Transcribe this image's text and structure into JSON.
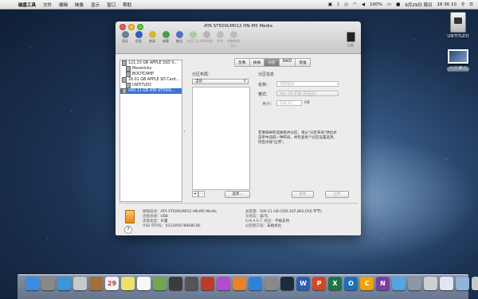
{
  "menubar": {
    "items": [
      "磁盘工具",
      "文件",
      "编辑",
      "映像",
      "显示",
      "窗口",
      "帮助"
    ],
    "battery": "100%",
    "date": "9月29日 周日",
    "time": "16 36 10"
  },
  "desktop": {
    "icons": [
      {
        "label": "UNTITLED"
      },
      {
        "label": "分区模式"
      }
    ]
  },
  "window": {
    "title": "ATA ST500LM012 HN-M5 Media",
    "toolbar": [
      {
        "label": "验证",
        "icon": "microscope-icon",
        "color": "#6e7f95",
        "dim": false
      },
      {
        "label": "信息",
        "icon": "info-icon",
        "color": "#2d5fbd",
        "dim": false
      },
      {
        "label": "刻录",
        "icon": "burn-icon",
        "color": "#d9b431",
        "dim": false
      },
      {
        "label": "装载",
        "icon": "mount-icon",
        "color": "#4a9d4a",
        "dim": false
      },
      {
        "label": "推出",
        "icon": "eject-icon",
        "color": "#4b72c0",
        "dim": false
      },
      {
        "label": "启用日志",
        "icon": "journal-icon",
        "color": "#7bb36b",
        "dim": true
      },
      {
        "label": "新建映像",
        "icon": "new-image-icon",
        "color": "#888",
        "dim": true
      },
      {
        "label": "转换",
        "icon": "convert-icon",
        "color": "#999",
        "dim": true
      },
      {
        "label": "调整映像大小",
        "icon": "resize-icon",
        "color": "#999",
        "dim": true
      }
    ],
    "log_label": "日志",
    "sidebar": [
      {
        "label": "121.33 GB APPLE SSD S...",
        "indent": false,
        "selected": false
      },
      {
        "label": "Mavericks",
        "indent": true,
        "selected": false
      },
      {
        "label": "BOOTCAMP",
        "indent": true,
        "selected": false
      },
      {
        "label": "16.01 GB APPLE SD Card...",
        "indent": false,
        "selected": false
      },
      {
        "label": "UNTITLED",
        "indent": true,
        "selected": false
      },
      {
        "label": "500.11 GB ATA ST500L...",
        "indent": false,
        "selected": true
      }
    ],
    "tabs": [
      "急救",
      "抹掉",
      "分区",
      "RAID",
      "恢复"
    ],
    "active_tab": "分区",
    "partition_layout_label": "分区布局：",
    "partition_layout_value": "当前",
    "partition_info_label": "分区信息",
    "name_label": "名称：",
    "name_placeholder": "可用空间",
    "format_label": "格式：",
    "format_value": "Mac OS 扩展 (日志式)",
    "size_label": "大小：",
    "size_value": "500.11",
    "size_unit": "GB",
    "description": "若要抹掉所选磁盘并分区，请从\"分区布局\"弹出式菜单中选取一种布局，并检查各个分区设置选项，然后点按\"应用\"。",
    "add_label": "+",
    "remove_label": "−",
    "options_label": "选项...",
    "revert_label": "复原",
    "apply_label": "应用",
    "help_label": "?",
    "info_left": [
      {
        "k": "磁盘描述：",
        "v": "ATA ST500LM012 HN-M5 Media"
      },
      {
        "k": "连接总线：",
        "v": "USB"
      },
      {
        "k": "连接类型：",
        "v": "外置"
      },
      {
        "k": "USB 序列号：",
        "v": "0123456789ABCDE"
      }
    ],
    "info_right": [
      {
        "k": "总容量：",
        "v": "500.11 GB (500,107,862,016 字节)"
      },
      {
        "k": "写状态：",
        "v": "读/写"
      },
      {
        "k": "S.M.A.R.T. 状态：",
        "v": "不被支持"
      },
      {
        "k": "分区图方案：",
        "v": "未格式化"
      }
    ]
  },
  "dock": {
    "apps": [
      {
        "icon": "finder-icon",
        "color": "#3b8de0",
        "glyph": ""
      },
      {
        "icon": "launchpad-icon",
        "color": "#888",
        "glyph": ""
      },
      {
        "icon": "safari-icon",
        "color": "#3a96d8",
        "glyph": ""
      },
      {
        "icon": "mail-icon",
        "color": "#c9c9c9",
        "glyph": ""
      },
      {
        "icon": "contacts-icon",
        "color": "#a2703b",
        "glyph": ""
      },
      {
        "icon": "calendar-icon",
        "color": "#f2f2f2",
        "glyph": "29"
      },
      {
        "icon": "notes-icon",
        "color": "#efe06a",
        "glyph": ""
      },
      {
        "icon": "reminders-icon",
        "color": "#f7f7f7",
        "glyph": ""
      },
      {
        "icon": "maps-icon",
        "color": "#6fa74f",
        "glyph": ""
      },
      {
        "icon": "photobooth-icon",
        "color": "#3c3c3c",
        "glyph": ""
      },
      {
        "icon": "facetime-icon",
        "color": "#555",
        "glyph": ""
      },
      {
        "icon": "photo-icon",
        "color": "#c03a2b",
        "glyph": ""
      },
      {
        "icon": "itunes-icon",
        "color": "#b54bd1",
        "glyph": ""
      },
      {
        "icon": "ibooks-icon",
        "color": "#e8832a",
        "glyph": ""
      },
      {
        "icon": "appstore-icon",
        "color": "#2f82d8",
        "glyph": ""
      },
      {
        "icon": "system-preferences-icon",
        "color": "#8a8a8a",
        "glyph": ""
      },
      {
        "icon": "photoshop-icon",
        "color": "#1d2c3d",
        "glyph": ""
      },
      {
        "icon": "word-icon",
        "color": "#2b5fb0",
        "glyph": "W"
      },
      {
        "icon": "powerpoint-icon",
        "color": "#d24726",
        "glyph": "P"
      },
      {
        "icon": "excel-icon",
        "color": "#217346",
        "glyph": "X"
      },
      {
        "icon": "outlook-icon",
        "color": "#1f6fb8",
        "glyph": "O"
      },
      {
        "icon": "lync-icon",
        "color": "#f0a30a",
        "glyph": "C"
      },
      {
        "icon": "onenote-icon",
        "color": "#7b3fa0",
        "glyph": "N"
      },
      {
        "icon": "messages-icon",
        "color": "#54a5e8",
        "glyph": ""
      },
      {
        "icon": "disk-utility-icon",
        "color": "#8d98a6",
        "glyph": ""
      },
      {
        "icon": "preview-icon",
        "color": "#cfcfcf",
        "glyph": ""
      },
      {
        "icon": "documents-folder-icon",
        "color": "#dfe6ef",
        "glyph": ""
      },
      {
        "icon": "downloads-folder-icon",
        "color": "#8fb3d9",
        "glyph": ""
      },
      {
        "icon": "trash-icon",
        "color": "#c8c8c8",
        "glyph": ""
      }
    ]
  }
}
